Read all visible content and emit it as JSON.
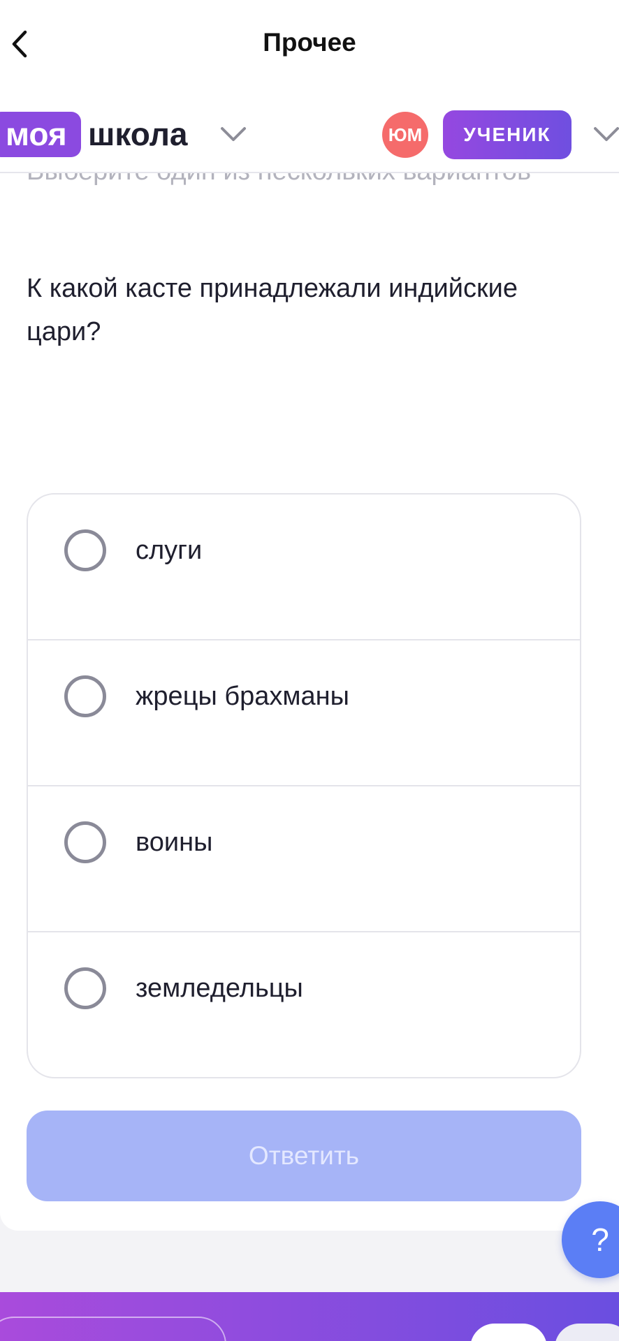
{
  "nav": {
    "back_icon": "chevron-left-icon",
    "title": "Прочее"
  },
  "school": {
    "logo_part1": "моя",
    "logo_part2": "школа",
    "avatar_initials": "ЮМ",
    "role": "УЧЕНИК"
  },
  "task": {
    "instruction": "Выберите один из нескольких вариантов",
    "question": "К какой касте принадлежали индийские цари?",
    "options": [
      {
        "label": "слуги"
      },
      {
        "label": "жрецы брахманы"
      },
      {
        "label": "воины"
      },
      {
        "label": "земледельцы"
      }
    ],
    "submit_label": "Ответить"
  },
  "help": {
    "label": "?"
  },
  "colors": {
    "brand_purple": "#8b4ae0",
    "avatar_red": "#f56b6b",
    "submit_disabled": "#a6b4f7",
    "help_blue": "#5b7ef5"
  }
}
